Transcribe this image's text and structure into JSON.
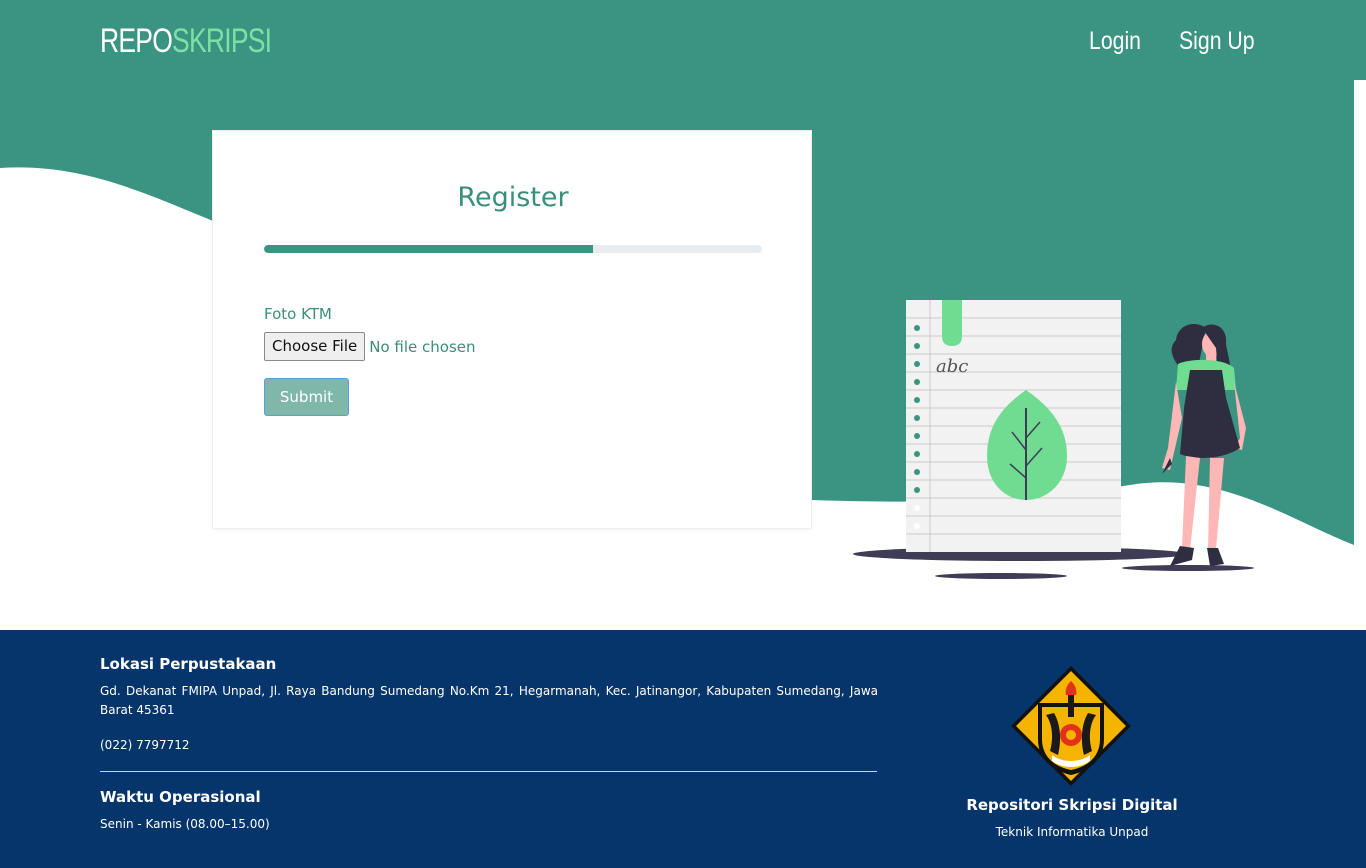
{
  "navbar": {
    "brand_part1": "REPO",
    "brand_part2": "SKRIPSI",
    "login": "Login",
    "signup": "Sign Up"
  },
  "register": {
    "title": "Register",
    "progress_percent": 66,
    "field_label": "Foto KTM",
    "file_button": "Choose File",
    "file_status": "No file chosen",
    "submit": "Submit"
  },
  "illustration": {
    "notebook_text": "abc"
  },
  "footer": {
    "location_heading": "Lokasi Perpustakaan",
    "address": "Gd. Dekanat FMIPA Unpad, Jl. Raya Bandung Sumedang No.Km 21, Hegarmanah, Kec. Jatinangor, Kabupaten Sumedang, Jawa Barat 45361",
    "phone": "(022) 7797712",
    "hours_heading": "Waktu Operasional",
    "hours": "Senin - Kamis (08.00–15.00)",
    "site_name": "Repositori Skripsi Digital",
    "department": "Teknik Informatika Unpad"
  },
  "colors": {
    "primary": "#3a9481",
    "accent_green": "#7fe0a4",
    "footer_bg": "#05356a"
  },
  "icons": [
    "university-logo",
    "notebook-illustration",
    "leaf-icon",
    "woman-illustration"
  ]
}
